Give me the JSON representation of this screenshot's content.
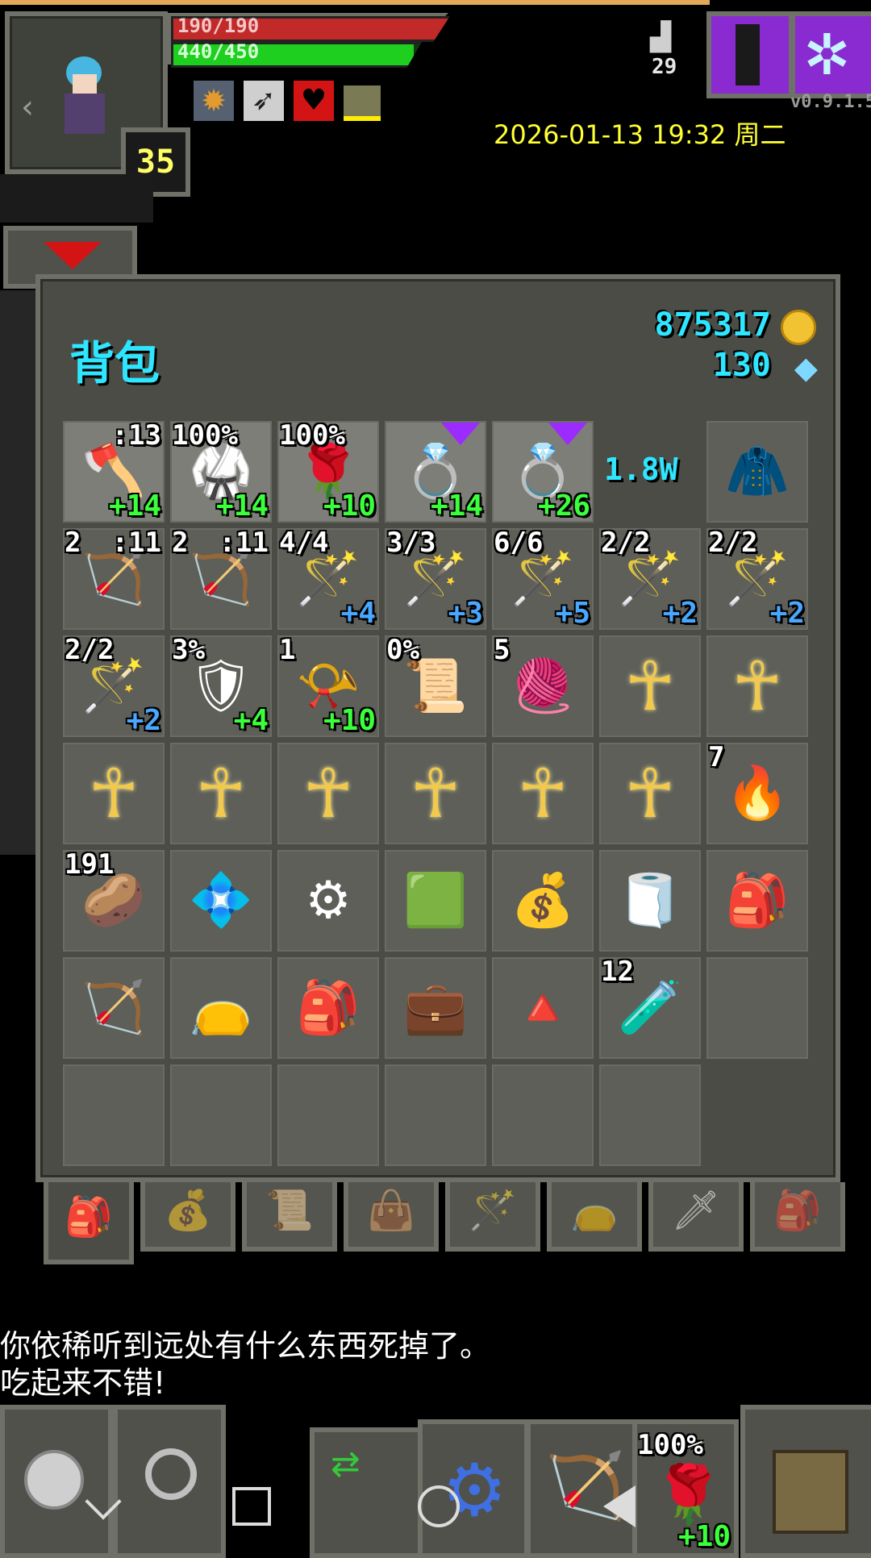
{
  "hud": {
    "hp_text": "190/190",
    "xp_text": "440/450",
    "hp_fraction": 1.0,
    "xp_fraction": 0.978,
    "level": "35",
    "depth": "29",
    "version": "v0.9.1.5",
    "datetime": "2026-01-13 19:32 周二",
    "buff_icons": [
      "sun-buff-icon",
      "arrow-buff-icon",
      "heart-buff-icon",
      "shield-buff-icon"
    ]
  },
  "backpack": {
    "title": "背包",
    "gold": "875317",
    "gems": "130",
    "rows": [
      [
        {
          "name": "blue-axe",
          "icon": "🪓",
          "tr": ":13",
          "lvl": "+14",
          "lvlc": "g",
          "light": true
        },
        {
          "name": "blue-armor",
          "icon": "🥋",
          "tl": "100%",
          "lvl": "+14",
          "lvlc": "g",
          "light": true
        },
        {
          "name": "red-flower",
          "icon": "🌹",
          "tl": "100%",
          "lvl": "+10",
          "lvlc": "g",
          "light": true
        },
        {
          "name": "amethyst-ring",
          "icon": "💍",
          "lvl": "+14",
          "lvlc": "g",
          "light": true,
          "gem": true
        },
        {
          "name": "amethyst-ring-2",
          "icon": "💍",
          "lvl": "+26",
          "lvlc": "g",
          "light": true,
          "gem": true
        },
        {
          "name": "value",
          "text": "1.8W"
        },
        {
          "name": "blue-cloak",
          "icon": "🧥"
        }
      ],
      [
        {
          "name": "silver-arrows",
          "icon": "🏹",
          "tl": "2",
          "tr": ":11"
        },
        {
          "name": "wooden-arrows",
          "icon": "🏹",
          "tl": "2",
          "tr": ":11"
        },
        {
          "name": "purple-wand",
          "icon": "🪄",
          "tl": "4/4",
          "lvl": "+4",
          "lvlc": "b"
        },
        {
          "name": "magenta-wand",
          "icon": "🪄",
          "tl": "3/3",
          "lvl": "+3",
          "lvlc": "b"
        },
        {
          "name": "fire-wand",
          "icon": "🪄",
          "tl": "6/6",
          "lvl": "+5",
          "lvlc": "b"
        },
        {
          "name": "gold-wand",
          "icon": "🪄",
          "tl": "2/2",
          "lvl": "+2",
          "lvlc": "b"
        },
        {
          "name": "iron-wand",
          "icon": "🪄",
          "tl": "2/2",
          "lvl": "+2",
          "lvlc": "b"
        }
      ],
      [
        {
          "name": "ice-wand",
          "icon": "🪄",
          "tl": "2/2",
          "lvl": "+2",
          "lvlc": "b"
        },
        {
          "name": "shield",
          "icon": "🛡",
          "tl": "3%",
          "lvl": "+4",
          "lvlc": "g"
        },
        {
          "name": "horn",
          "icon": "📯",
          "tl": "1",
          "lvl": "+10",
          "lvlc": "g"
        },
        {
          "name": "scroll-quill",
          "icon": "📜",
          "tl": "0%"
        },
        {
          "name": "green-cloth",
          "icon": "🧶",
          "tl": "5"
        },
        {
          "name": "ankh",
          "icon": "☥"
        },
        {
          "name": "ankh",
          "icon": "☥"
        }
      ],
      [
        {
          "name": "ankh",
          "icon": "☥"
        },
        {
          "name": "ankh",
          "icon": "☥"
        },
        {
          "name": "ankh",
          "icon": "☥"
        },
        {
          "name": "ankh",
          "icon": "☥"
        },
        {
          "name": "ankh",
          "icon": "☥"
        },
        {
          "name": "ankh",
          "icon": "☥"
        },
        {
          "name": "torch",
          "icon": "🔥",
          "tl": "7"
        }
      ],
      [
        {
          "name": "food-pouch",
          "icon": "🥔",
          "tl": "191"
        },
        {
          "name": "crystal-amulet",
          "icon": "💠"
        },
        {
          "name": "gear",
          "icon": "⚙"
        },
        {
          "name": "emerald",
          "icon": "🟩"
        },
        {
          "name": "teal-bag",
          "icon": "💰"
        },
        {
          "name": "leather-rolls",
          "icon": "🧻"
        },
        {
          "name": "red-satchel",
          "icon": "🎒"
        }
      ],
      [
        {
          "name": "quiver",
          "icon": "🏹"
        },
        {
          "name": "red-pouch",
          "icon": "👝"
        },
        {
          "name": "canvas-backpack",
          "icon": "🎒"
        },
        {
          "name": "leather-backpack",
          "icon": "💼"
        },
        {
          "name": "crystal-pyramid",
          "icon": "🔺"
        },
        {
          "name": "blue-potion",
          "icon": "🧪",
          "tl": "12"
        },
        {
          "name": "empty"
        }
      ],
      [
        {
          "name": "empty"
        },
        {
          "name": "empty"
        },
        {
          "name": "empty"
        },
        {
          "name": "empty"
        },
        {
          "name": "empty"
        },
        {
          "name": "empty"
        }
      ]
    ]
  },
  "tabs": [
    "backpack-tab",
    "teal-bag-tab",
    "scroll-tab",
    "satchel-tab",
    "wand-tab",
    "pouch-tab",
    "sword-tab",
    "bag-tab"
  ],
  "log": {
    "line1": "你依稀听到远处有什么东西死掉了。",
    "line2": "吃起来不错!"
  },
  "quickslot": {
    "badge": "100%",
    "level": "+10"
  },
  "colors": {
    "hp": "#c22a2a",
    "xp": "#1fcf1f",
    "gold_text": "#2ee6ff",
    "datetime": "#ffff33"
  }
}
